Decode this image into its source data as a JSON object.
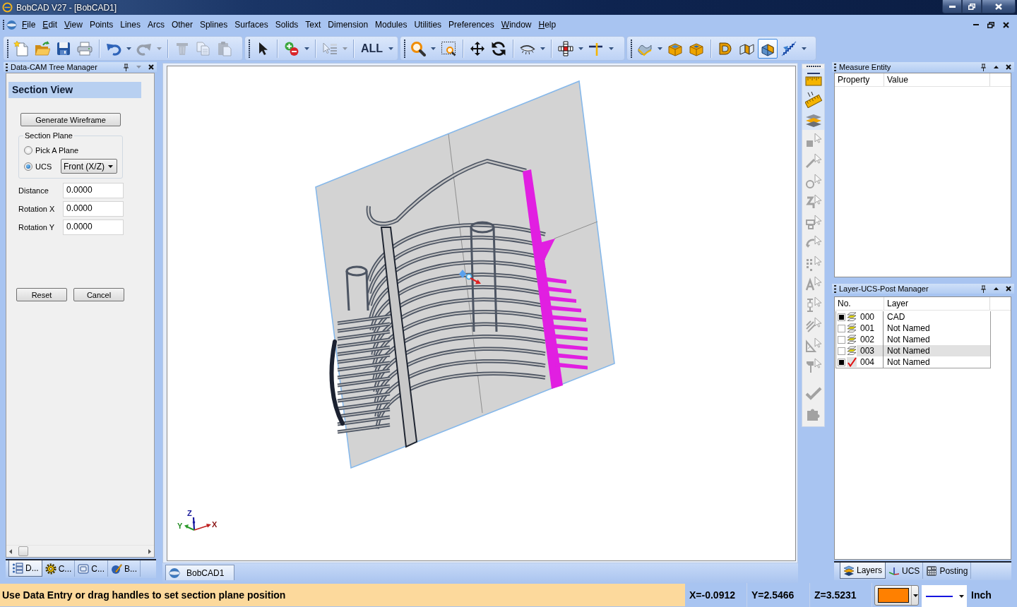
{
  "window": {
    "title": "BobCAD V27 - [BobCAD1]"
  },
  "menu": [
    {
      "label": "File",
      "mnemonic": true
    },
    {
      "label": "Edit",
      "mnemonic": true
    },
    {
      "label": "View",
      "mnemonic": true
    },
    {
      "label": "Points",
      "mnemonic": false
    },
    {
      "label": "Lines",
      "mnemonic": false
    },
    {
      "label": "Arcs",
      "mnemonic": false
    },
    {
      "label": "Other",
      "mnemonic": false
    },
    {
      "label": "Splines",
      "mnemonic": false
    },
    {
      "label": "Surfaces",
      "mnemonic": false
    },
    {
      "label": "Solids",
      "mnemonic": false
    },
    {
      "label": "Text",
      "mnemonic": false
    },
    {
      "label": "Dimension",
      "mnemonic": false
    },
    {
      "label": "Modules",
      "mnemonic": false
    },
    {
      "label": "Utilities",
      "mnemonic": false
    },
    {
      "label": "Preferences",
      "mnemonic": false
    },
    {
      "label": "Window",
      "mnemonic": true
    },
    {
      "label": "Help",
      "mnemonic": true
    }
  ],
  "toolbars": [
    {
      "items": [
        {
          "kind": "button",
          "disabled": false,
          "pressed": false
        },
        {
          "kind": "button",
          "disabled": false,
          "pressed": false
        },
        {
          "kind": "button",
          "disabled": false,
          "pressed": false
        },
        {
          "kind": "button",
          "disabled": false,
          "pressed": false
        },
        {
          "kind": "separator"
        },
        {
          "kind": "split",
          "disabled": false,
          "pressed": false
        },
        {
          "kind": "split",
          "disabled": true,
          "pressed": false
        },
        {
          "kind": "separator"
        },
        {
          "kind": "button",
          "disabled": true,
          "pressed": false
        },
        {
          "kind": "button",
          "disabled": true,
          "pressed": false
        },
        {
          "kind": "button",
          "disabled": true,
          "pressed": false
        }
      ]
    },
    {
      "items": [
        {
          "kind": "button",
          "disabled": false,
          "pressed": false
        },
        {
          "kind": "separator"
        },
        {
          "kind": "split",
          "disabled": false,
          "pressed": false
        },
        {
          "kind": "separator"
        },
        {
          "kind": "split",
          "disabled": true,
          "pressed": false
        },
        {
          "kind": "separator"
        },
        {
          "kind": "label_split",
          "label": "ALL",
          "disabled": false,
          "pressed": false
        }
      ]
    },
    {
      "items": [
        {
          "kind": "split",
          "disabled": false,
          "pressed": false
        },
        {
          "kind": "button",
          "disabled": false,
          "pressed": false
        },
        {
          "kind": "separator"
        },
        {
          "kind": "button",
          "disabled": false,
          "pressed": false
        },
        {
          "kind": "button",
          "disabled": false,
          "pressed": false
        },
        {
          "kind": "separator"
        },
        {
          "kind": "split",
          "disabled": false,
          "pressed": false
        },
        {
          "kind": "separator"
        },
        {
          "kind": "split",
          "disabled": false,
          "pressed": false
        },
        {
          "kind": "split",
          "disabled": false,
          "pressed": false
        }
      ]
    },
    {
      "items": [
        {
          "kind": "split",
          "disabled": false,
          "pressed": false
        },
        {
          "kind": "button",
          "disabled": false,
          "pressed": false
        },
        {
          "kind": "button",
          "disabled": false,
          "pressed": false
        },
        {
          "kind": "separator"
        },
        {
          "kind": "button",
          "disabled": false,
          "pressed": false
        },
        {
          "kind": "button",
          "disabled": false,
          "pressed": false
        },
        {
          "kind": "button",
          "disabled": false,
          "pressed": true
        },
        {
          "kind": "split",
          "disabled": false,
          "pressed": false
        }
      ]
    }
  ],
  "tree_manager": {
    "title": "Data-CAM Tree Manager",
    "heading": "Section View",
    "generate_button": "Generate Wireframe",
    "section_plane": {
      "title": "Section Plane",
      "options": [
        {
          "label": "Pick A Plane",
          "selected": false
        },
        {
          "label": "UCS",
          "selected": true,
          "dropdown": "Front (X/Z)"
        }
      ]
    },
    "fields": [
      {
        "label": "Distance",
        "value": "0.0000"
      },
      {
        "label": "Rotation X",
        "value": "0.0000"
      },
      {
        "label": "Rotation Y",
        "value": "0.0000"
      }
    ],
    "buttons": [
      "Reset",
      "Cancel"
    ],
    "tabs": [
      {
        "label": "D...",
        "selected": true
      },
      {
        "label": "C...",
        "selected": false
      },
      {
        "label": "C...",
        "selected": false
      },
      {
        "label": "B...",
        "selected": false
      }
    ]
  },
  "viewport": {
    "axes": {
      "x": "X",
      "y": "Y",
      "z": "Z"
    },
    "document_tabs": [
      {
        "label": "BobCAD1",
        "selected": true
      }
    ]
  },
  "side_toolbar": {
    "items": [
      {
        "kind": "button",
        "disabled": false
      },
      {
        "kind": "button",
        "disabled": false
      },
      {
        "kind": "button",
        "disabled": false
      },
      {
        "kind": "button",
        "disabled": true
      },
      {
        "kind": "button",
        "disabled": true
      },
      {
        "kind": "button",
        "disabled": true
      },
      {
        "kind": "button",
        "disabled": true
      },
      {
        "kind": "button",
        "disabled": true
      },
      {
        "kind": "button",
        "disabled": true
      },
      {
        "kind": "button",
        "disabled": true
      },
      {
        "kind": "button",
        "disabled": true
      },
      {
        "kind": "button",
        "disabled": true
      },
      {
        "kind": "button",
        "disabled": true
      },
      {
        "kind": "button",
        "disabled": true
      },
      {
        "kind": "button",
        "disabled": true
      },
      {
        "kind": "separator"
      },
      {
        "kind": "button",
        "disabled": true
      },
      {
        "kind": "button",
        "disabled": true
      }
    ]
  },
  "measure_entity": {
    "title": "Measure Entity",
    "columns": [
      "Property",
      "Value"
    ]
  },
  "layer_manager": {
    "title": "Layer-UCS-Post Manager",
    "columns": [
      "No.",
      "Layer"
    ],
    "rows": [
      {
        "checked": true,
        "current": false,
        "selected": false,
        "number": "000",
        "name": "CAD"
      },
      {
        "checked": false,
        "current": false,
        "selected": false,
        "number": "001",
        "name": "Not Named"
      },
      {
        "checked": false,
        "current": false,
        "selected": false,
        "number": "002",
        "name": "Not Named"
      },
      {
        "checked": false,
        "current": false,
        "selected": true,
        "number": "003",
        "name": "Not Named"
      },
      {
        "checked": true,
        "current": true,
        "selected": false,
        "number": "004",
        "name": "Not Named"
      }
    ],
    "tabs": [
      {
        "label": "Layers",
        "selected": true
      },
      {
        "label": "UCS",
        "selected": false
      },
      {
        "label": "Posting",
        "selected": false
      }
    ]
  },
  "status_bar": {
    "message": "Use Data Entry or drag handles to set section plane position",
    "x": "X=-0.0912",
    "y": "Y=2.5466",
    "z": "Z=3.5231",
    "color": "#ff8000",
    "units": "Inch"
  }
}
